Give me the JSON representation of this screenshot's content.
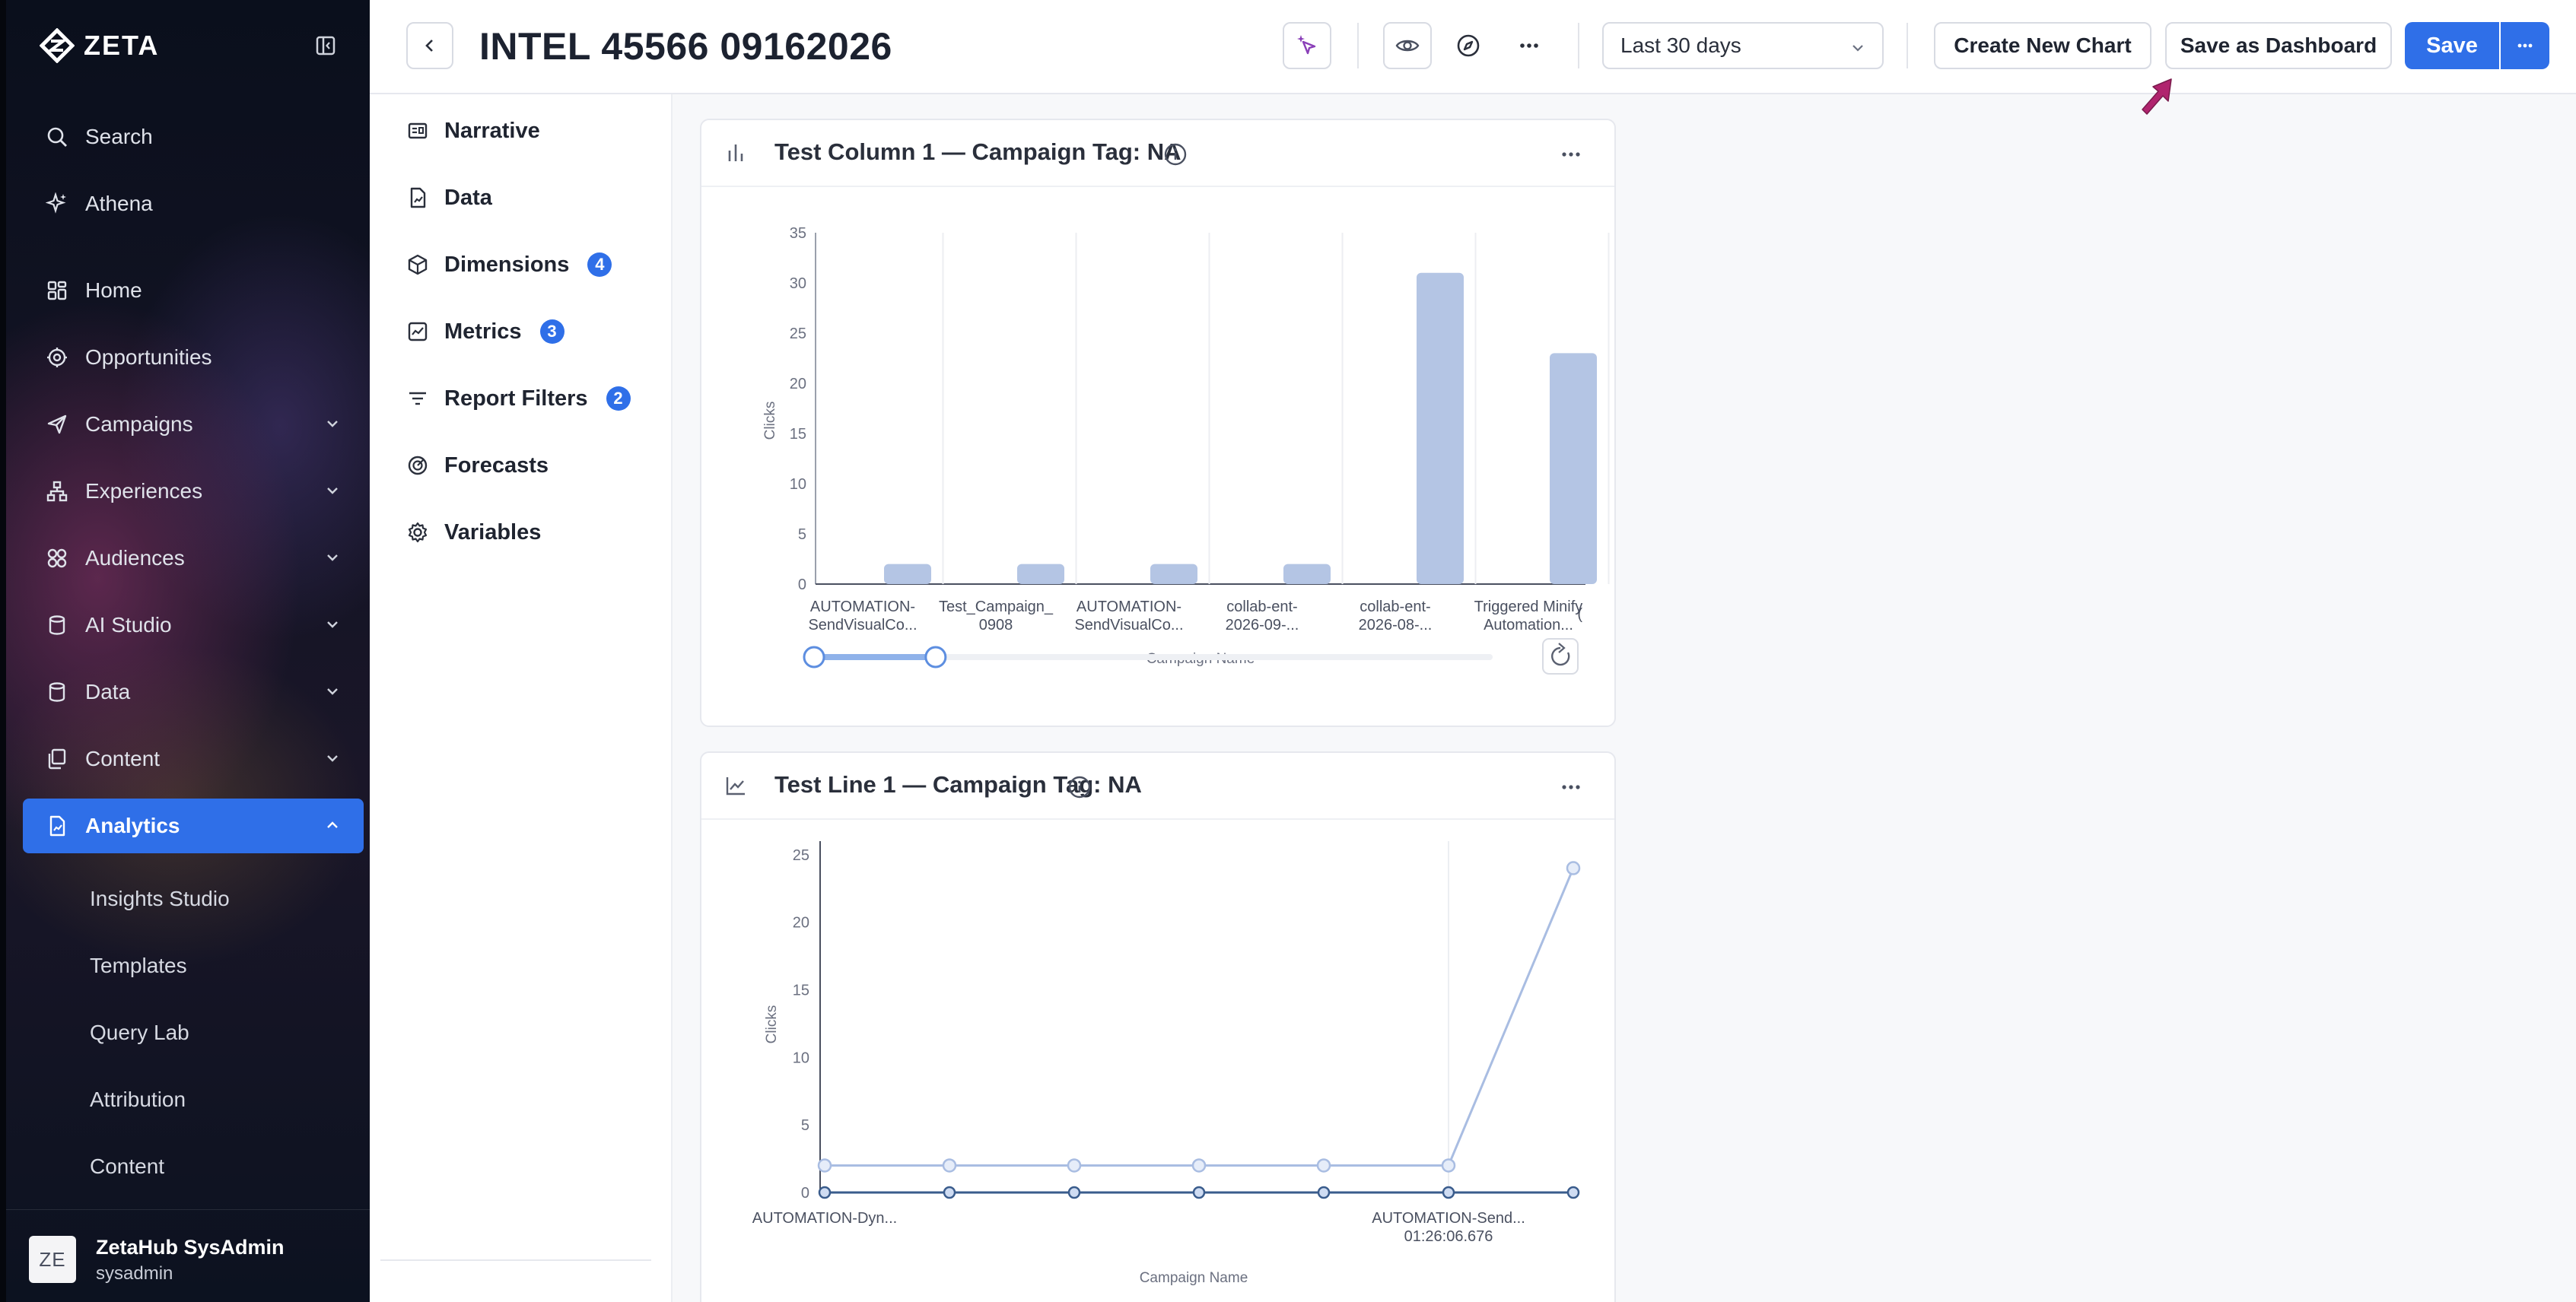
{
  "sidebar": {
    "logo": "ZETA",
    "items": [
      {
        "label": "Search",
        "icon": "search-icon",
        "top": 148
      },
      {
        "label": "Athena",
        "icon": "sparkle-icon",
        "top": 232
      }
    ],
    "nav": [
      {
        "key": "home",
        "label": "Home",
        "icon": "home-icon",
        "has_chevron": false
      },
      {
        "key": "opportunities",
        "label": "Opportunities",
        "icon": "target-icon",
        "has_chevron": false
      },
      {
        "key": "campaigns",
        "label": "Campaigns",
        "icon": "send-icon",
        "has_chevron": true
      },
      {
        "key": "experiences",
        "label": "Experiences",
        "icon": "flow-icon",
        "has_chevron": true
      },
      {
        "key": "audiences",
        "label": "Audiences",
        "icon": "audience-icon",
        "has_chevron": true
      },
      {
        "key": "ai-studio",
        "label": "AI Studio",
        "icon": "database-icon",
        "has_chevron": true
      },
      {
        "key": "data",
        "label": "Data",
        "icon": "database-icon",
        "has_chevron": true
      },
      {
        "key": "content",
        "label": "Content",
        "icon": "content-icon",
        "has_chevron": true
      },
      {
        "key": "analytics",
        "label": "Analytics",
        "icon": "analytics-icon",
        "has_chevron": true,
        "active": true
      }
    ],
    "analytics_sub": [
      "Insights Studio",
      "Templates",
      "Query Lab",
      "Attribution",
      "Content"
    ],
    "user": {
      "initials": "ZE",
      "name": "ZetaHub SysAdmin",
      "role": "sysadmin"
    }
  },
  "header": {
    "title": "INTEL 45566 09162026",
    "date_range": "Last 30 days",
    "create_chart": "Create New Chart",
    "save_dashboard": "Save as Dashboard",
    "save": "Save"
  },
  "config_panel": {
    "items": [
      {
        "label": "Narrative",
        "icon": "narrative-icon",
        "badge": null
      },
      {
        "label": "Data",
        "icon": "file-icon",
        "badge": null
      },
      {
        "label": "Dimensions",
        "icon": "cube-icon",
        "badge": "4"
      },
      {
        "label": "Metrics",
        "icon": "metric-icon",
        "badge": "3"
      },
      {
        "label": "Report Filters",
        "icon": "filter-icon",
        "badge": "2"
      },
      {
        "label": "Forecasts",
        "icon": "forecast-icon",
        "badge": null
      },
      {
        "label": "Variables",
        "icon": "gear-icon",
        "badge": null
      }
    ]
  },
  "colors": {
    "accent": "#2f6fe8",
    "bar": "#b4c5e4",
    "line": "#a9bde2",
    "line_dark": "#3a5c8c"
  },
  "chart_data": [
    {
      "type": "bar",
      "title": "Test Column 1 — Campaign Tag: NA",
      "categories": [
        [
          "AUTOMATION-",
          "SendVisualCo..."
        ],
        [
          "Test_Campaign_",
          "0908"
        ],
        [
          "AUTOMATION-",
          "SendVisualCo..."
        ],
        [
          "collab-ent-",
          "2026-09-..."
        ],
        [
          "collab-ent-",
          "2026-08-..."
        ],
        [
          "Triggered Minify",
          "Automation..."
        ]
      ],
      "values": [
        2,
        2,
        2,
        2,
        31,
        23
      ],
      "truncated_next_label": "(",
      "xlabel": "Campaign Name",
      "ylabel": "Clicks",
      "ylim": [
        0,
        35
      ],
      "yticks": [
        0,
        5,
        10,
        15,
        20,
        25,
        30,
        35
      ],
      "slider": {
        "start": 0,
        "end": 0.18
      }
    },
    {
      "type": "line",
      "title": "Test Line 1 — Campaign Tag: NA",
      "points": 7,
      "series": [
        {
          "values": [
            2,
            2,
            2,
            2,
            2,
            2,
            24
          ]
        },
        {
          "values": [
            0,
            0,
            0,
            0,
            0,
            0,
            0
          ]
        }
      ],
      "x_tick_labels": [
        {
          "index": 0,
          "lines": [
            "AUTOMATION-Dyn..."
          ]
        },
        {
          "index": 5,
          "lines": [
            "AUTOMATION-Send...",
            "01:26:06.676"
          ]
        }
      ],
      "xlabel": "Campaign Name",
      "ylabel": "Clicks",
      "ylim": [
        0,
        26
      ],
      "yticks": [
        0,
        5,
        10,
        15,
        20,
        25
      ]
    }
  ]
}
